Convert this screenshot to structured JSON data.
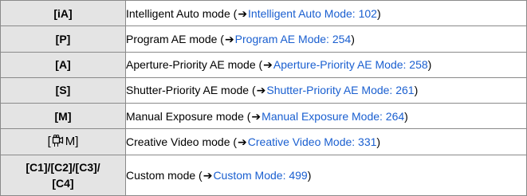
{
  "rows": [
    {
      "mode": "[iA]",
      "desc": "Intelligent Auto mode (",
      "arrow": "➔",
      "link": "Intelligent Auto Mode: 102",
      "end": ")"
    },
    {
      "mode": "[P]",
      "desc": "Program AE mode (",
      "arrow": "➔",
      "link": "Program AE Mode: 254",
      "end": ")"
    },
    {
      "mode": "[A]",
      "desc": "Aperture-Priority AE mode (",
      "arrow": "➔",
      "link": "Aperture-Priority AE Mode: 258",
      "end": ")"
    },
    {
      "mode": "[S]",
      "desc": "Shutter-Priority AE mode (",
      "arrow": "➔",
      "link": "Shutter-Priority AE Mode: 261",
      "end": ")"
    },
    {
      "mode": "[M]",
      "desc": "Manual Exposure mode (",
      "arrow": "➔",
      "link": "Manual Exposure Mode: 264",
      "end": ")"
    },
    {
      "mode_prefix": "[",
      "mode_icon": "creative-video-icon",
      "mode_suffix": "M]",
      "desc": "Creative Video mode (",
      "arrow": "➔",
      "link": "Creative Video Mode: 331",
      "end": ")"
    },
    {
      "mode_line1": "[C1]/[C2]/[C3]/",
      "mode_line2": "[C4]",
      "desc": "Custom mode (",
      "arrow": "➔",
      "link": "Custom Mode: 499",
      "end": ")"
    }
  ],
  "colors": {
    "link": "#1a5fd0",
    "mode_cell_bg": "#e4e4e4",
    "border": "#8a8a8a"
  }
}
